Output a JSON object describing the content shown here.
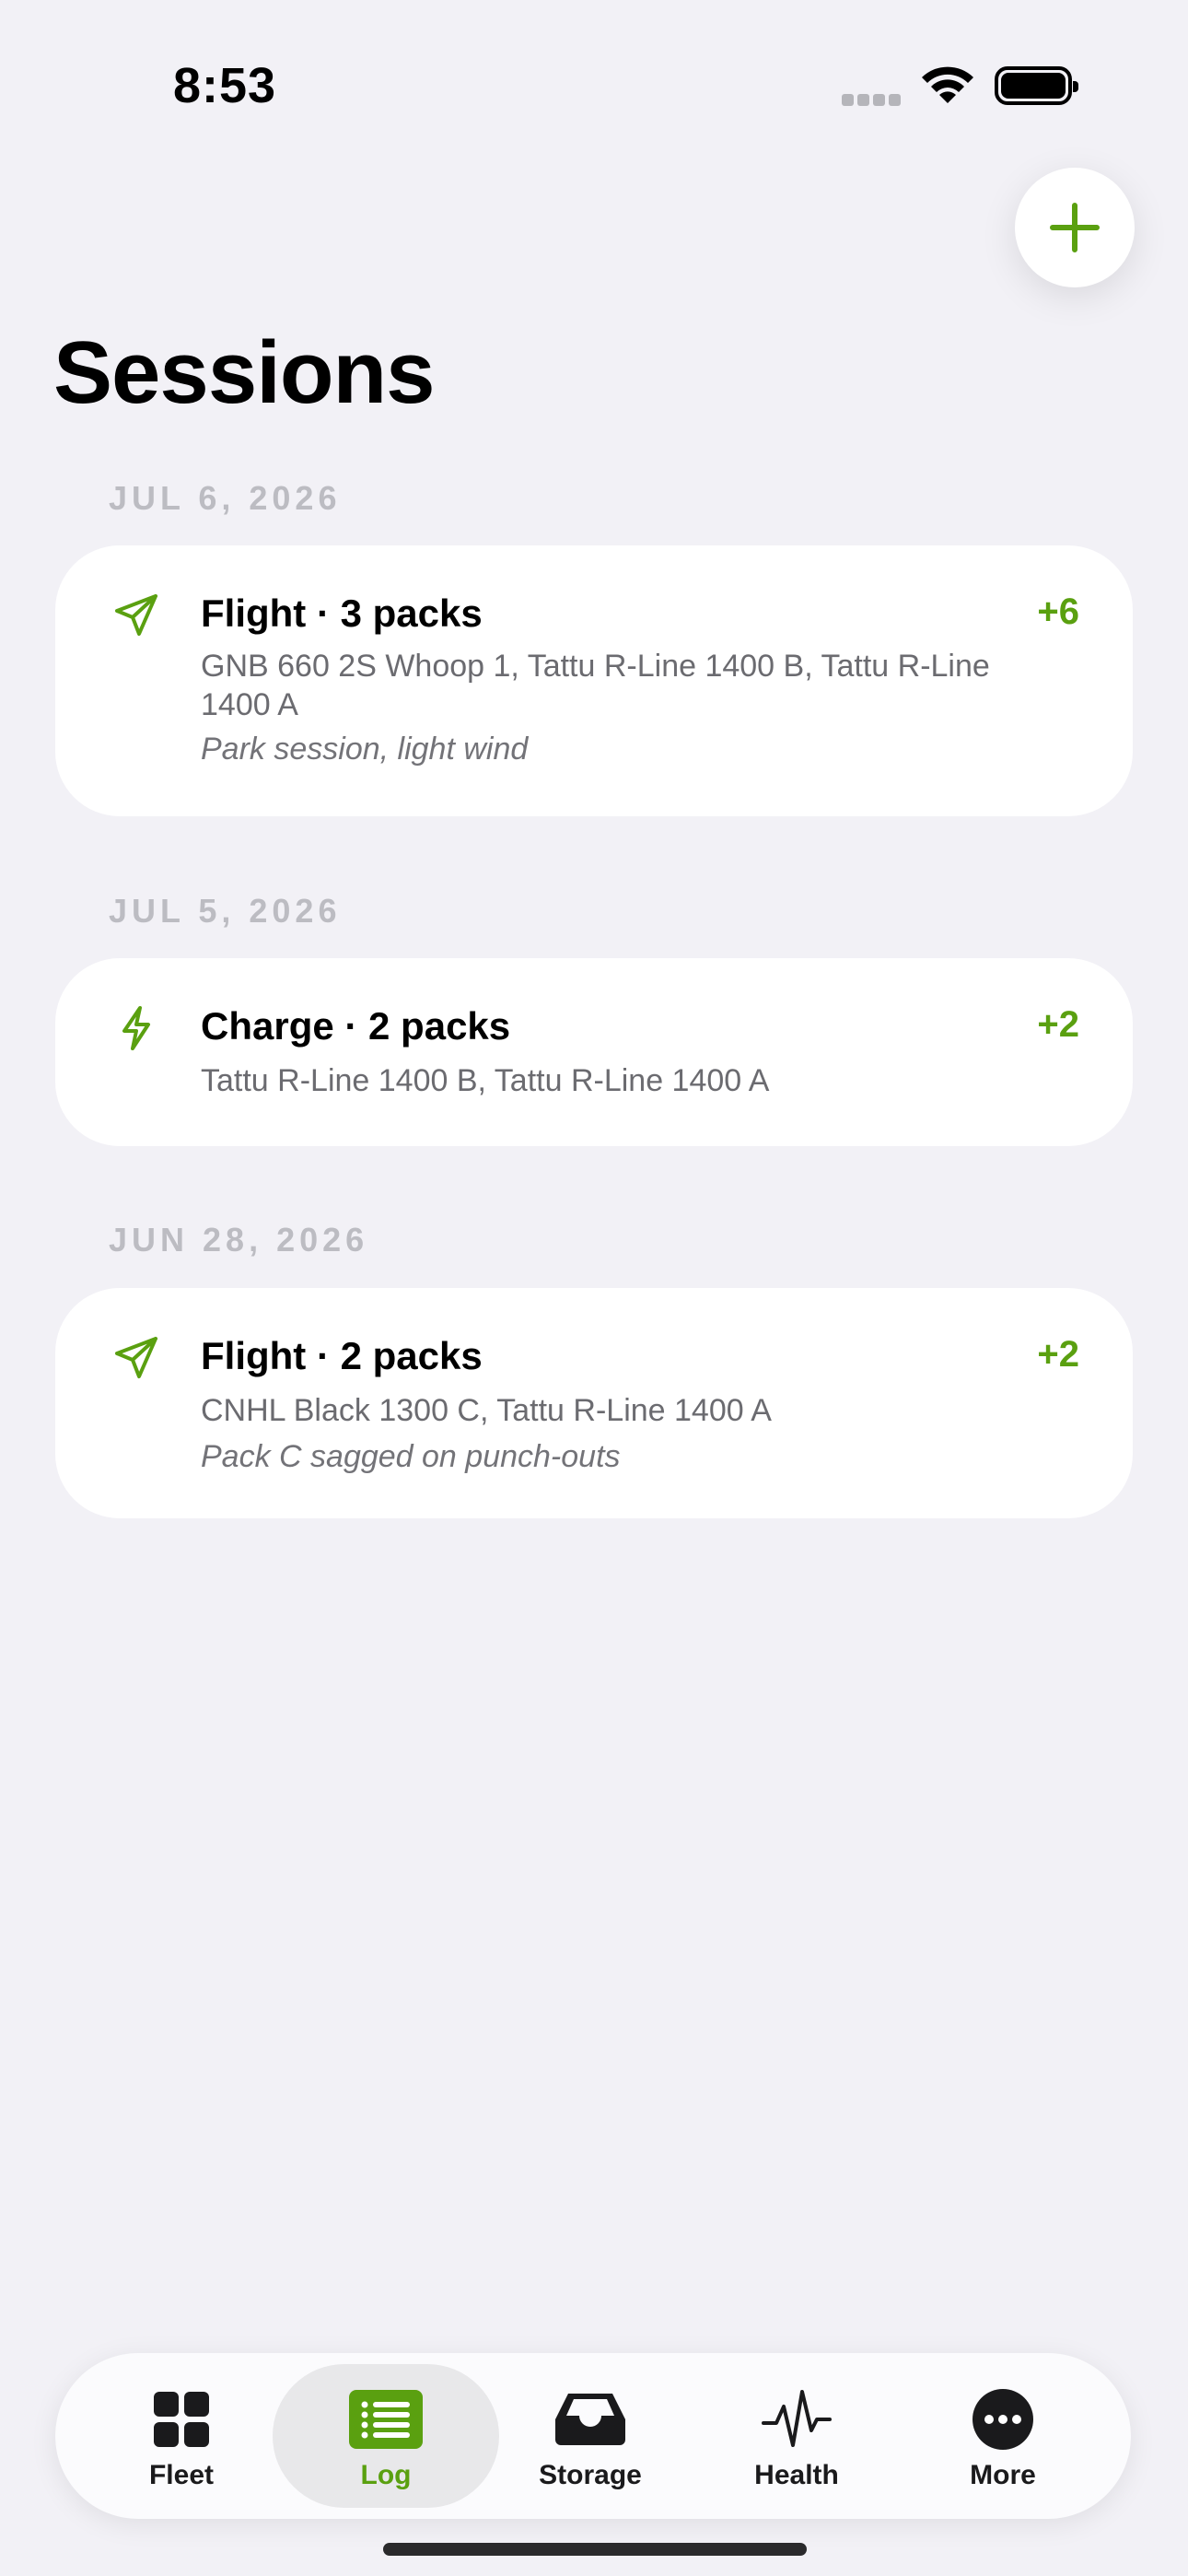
{
  "status_bar": {
    "time": "8:53"
  },
  "header": {
    "title": "Sessions",
    "add_icon": "plus-icon"
  },
  "sessions": [
    {
      "date": "JUL 6, 2026",
      "icon": "paper-plane-icon",
      "title": "Flight · 3 packs",
      "delta": "+6",
      "packs": "GNB 660 2S Whoop 1, Tattu R-Line 1400 B, Tattu R-Line 1400 A",
      "note": "Park session, light wind"
    },
    {
      "date": "JUL 5, 2026",
      "icon": "lightning-bolt-icon",
      "title": "Charge · 2 packs",
      "delta": "+2",
      "packs": "Tattu R-Line 1400 B, Tattu R-Line 1400 A",
      "note": ""
    },
    {
      "date": "JUN 28, 2026",
      "icon": "paper-plane-icon",
      "title": "Flight · 2 packs",
      "delta": "+2",
      "packs": "CNHL Black 1300 C, Tattu R-Line 1400 A",
      "note": "Pack C sagged on punch-outs"
    }
  ],
  "tab_bar": {
    "active": "Log",
    "tabs": [
      {
        "label": "Fleet",
        "icon": "grid-icon"
      },
      {
        "label": "Log",
        "icon": "list-icon"
      },
      {
        "label": "Storage",
        "icon": "tray-icon"
      },
      {
        "label": "Health",
        "icon": "waveform-icon"
      },
      {
        "label": "More",
        "icon": "more-icon"
      }
    ]
  },
  "colors": {
    "accent": "#5aa010",
    "background": "#f2f1f6",
    "card": "#ffffff",
    "date_header": "#bcbcc2"
  }
}
